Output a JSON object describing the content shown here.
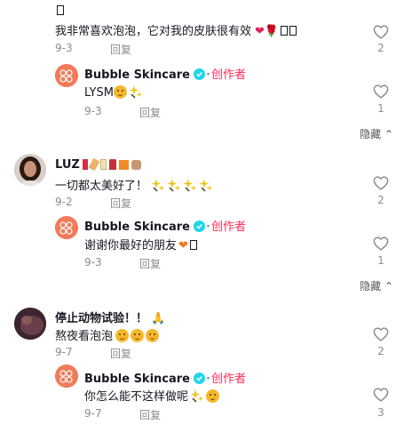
{
  "hide_label": "隐藏",
  "reply_label": "回复",
  "creator_label": "创作者",
  "author_name": "Bubble Skincare",
  "comments": [
    {
      "username": "",
      "text": "我非常喜欢泡泡，它对我的皮肤很有效",
      "date": "9-3",
      "likes": "2",
      "reply": {
        "text": "LYSM",
        "date": "9-3",
        "likes": "1"
      }
    },
    {
      "username": "LUZ",
      "text": "一切都太美好了！",
      "date": "9-2",
      "likes": "2",
      "reply": {
        "text": "谢谢你最好的朋友",
        "date": "9-3",
        "likes": "1"
      }
    },
    {
      "username": "停止动物试验！！",
      "text": "熬夜看泡泡",
      "date": "9-7",
      "likes": "2",
      "reply": {
        "text": "你怎么能不这样做呢",
        "date": "9-7",
        "likes": "3"
      }
    }
  ],
  "colors": {
    "creator": "#fe2c55",
    "verified": "#20d5ec",
    "muted": "#8a8b91"
  }
}
